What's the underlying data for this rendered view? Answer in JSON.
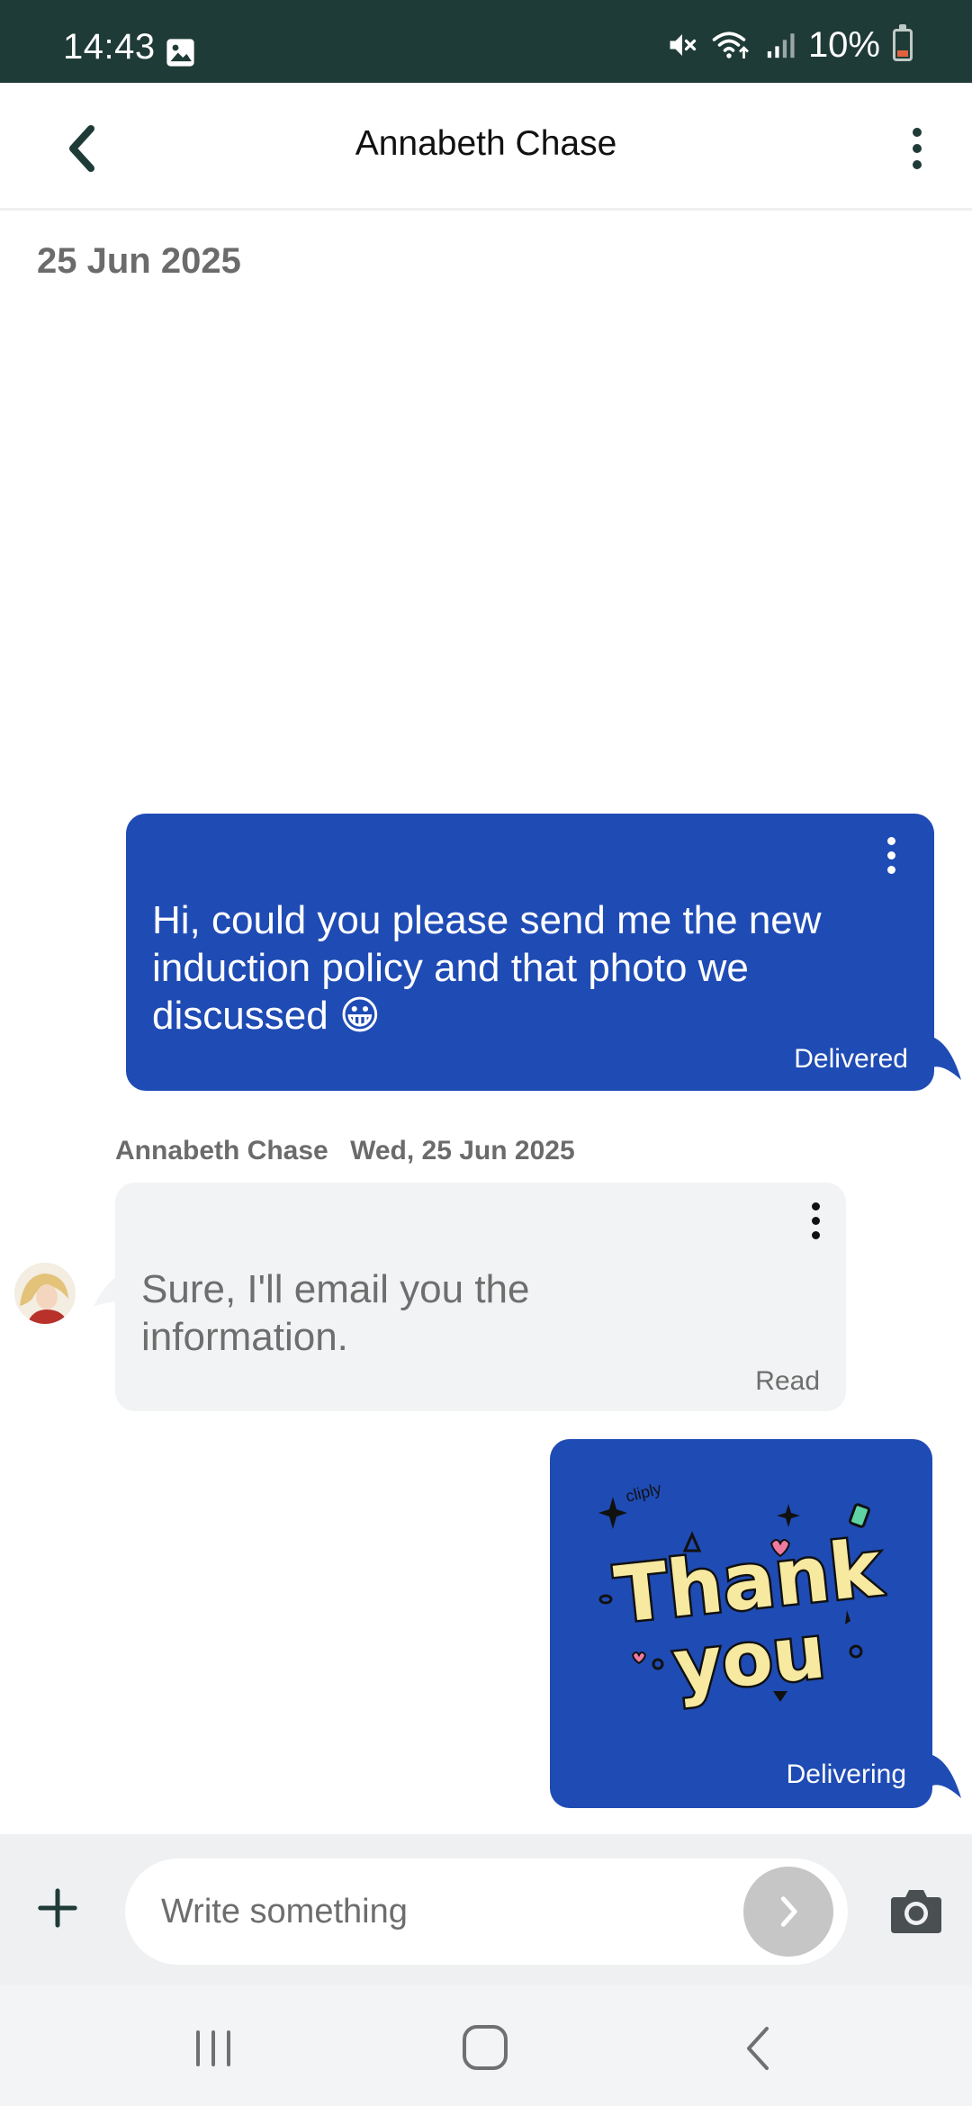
{
  "status_bar": {
    "time": "14:43",
    "battery": "10%",
    "icons": [
      "image-notification-icon",
      "mute-icon",
      "wifi-icon",
      "signal-icon",
      "battery-icon"
    ]
  },
  "header": {
    "title": "Annabeth Chase",
    "back_icon": "back-arrow-icon",
    "menu_icon": "more-vertical-icon"
  },
  "conversation": {
    "date_header": "25 Jun 2025",
    "messages": [
      {
        "direction": "outgoing",
        "text": "Hi, could you please send me the new induction policy and that photo we discussed 😀",
        "status": "Delivered"
      },
      {
        "direction": "incoming",
        "sender": "Annabeth Chase",
        "timestamp": "Wed, 25 Jun 2025",
        "text": "Sure, I'll email you the information.",
        "status": "Read"
      },
      {
        "direction": "outgoing",
        "type": "sticker",
        "sticker_text": {
          "brand": "cliply",
          "line1": "Thank",
          "line2": "you"
        },
        "status": "Delivering"
      }
    ]
  },
  "composer": {
    "placeholder": "Write something",
    "add_icon": "plus-icon",
    "send_icon": "send-arrow-icon",
    "camera_icon": "camera-icon"
  },
  "colors": {
    "status_bar": "#1f3b37",
    "outgoing_bubble": "#1f4bb4",
    "incoming_bubble": "#f2f3f4",
    "accent_dark": "#1f3b37"
  }
}
